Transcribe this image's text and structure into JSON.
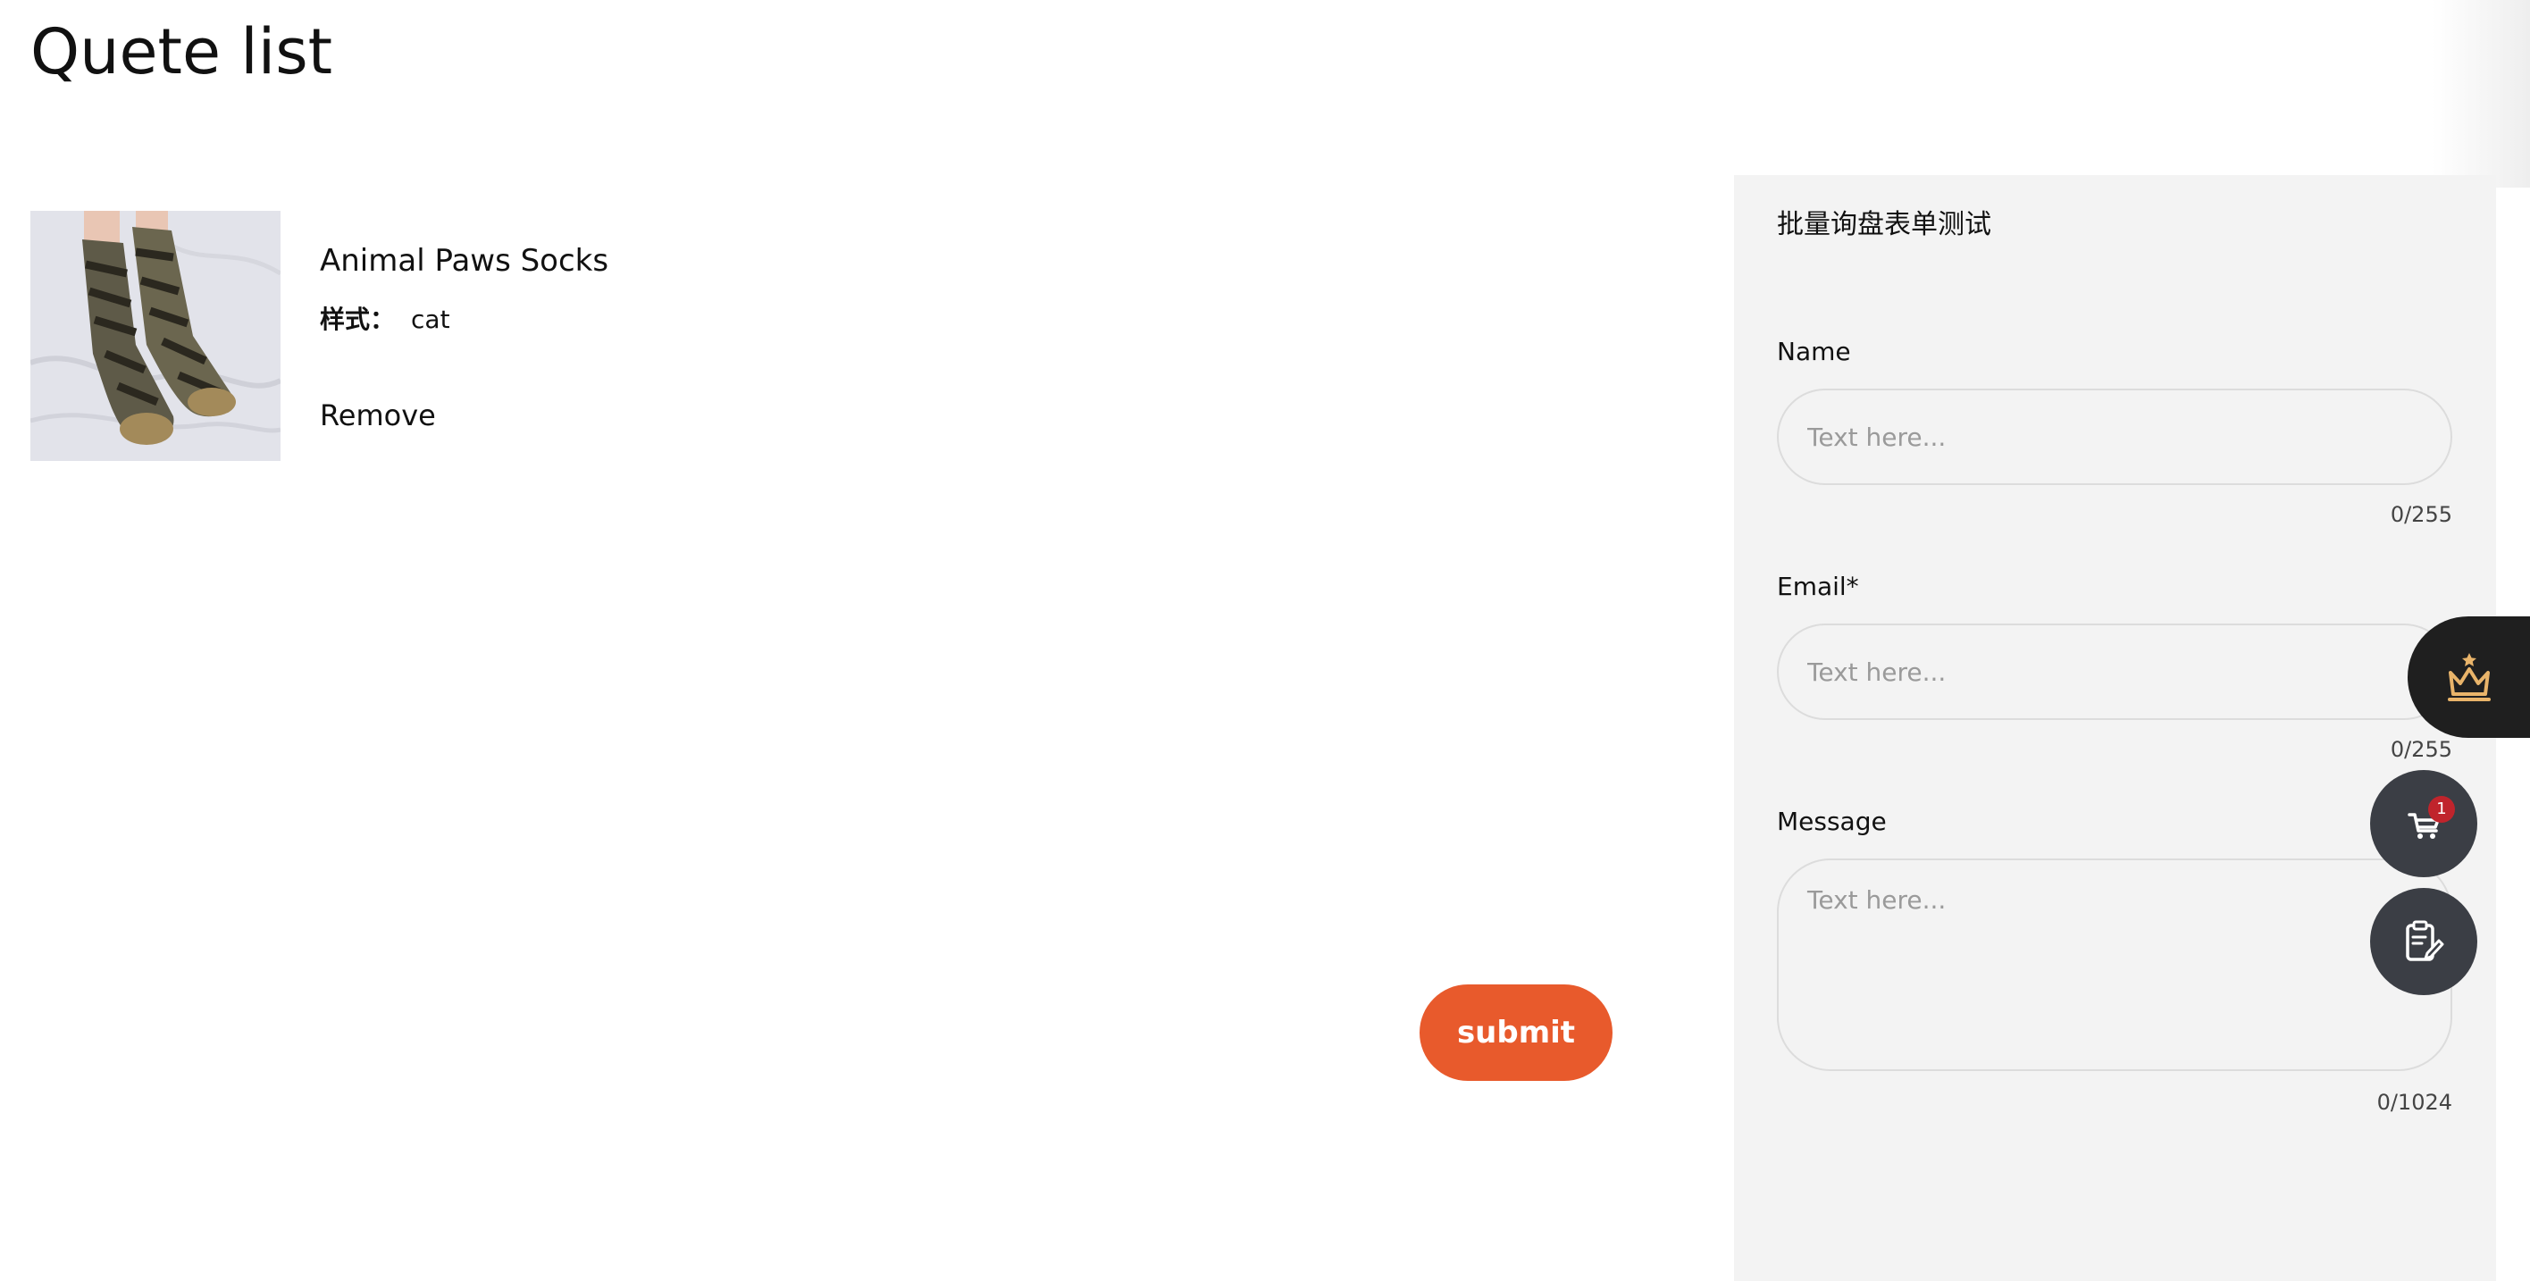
{
  "page": {
    "title": "Quete list"
  },
  "product": {
    "name": "Animal Paws Socks",
    "style_label": "样式：",
    "style_value": "cat",
    "remove_label": "Remove"
  },
  "form": {
    "title": "批量询盘表单测试",
    "fields": [
      {
        "label": "Name",
        "placeholder": "Text here...",
        "value": "",
        "count": "0/255"
      },
      {
        "label": "Email*",
        "placeholder": "Text here...",
        "value": "",
        "count": "0/255"
      },
      {
        "label": "Message",
        "placeholder": "Text here...",
        "value": "",
        "count": "0/1024"
      }
    ],
    "submit_label": "submit"
  },
  "floating": {
    "vip_icon": "crown-icon",
    "cart_icon": "cart-icon",
    "cart_count": "1",
    "quote_icon": "clipboard-edit-icon"
  },
  "colors": {
    "accent": "#e85a2c",
    "panel_bg": "#f3f3f3",
    "badge": "#c0242c",
    "vip_icon": "#e9b46a",
    "floating_dark": "#3b3e45"
  }
}
